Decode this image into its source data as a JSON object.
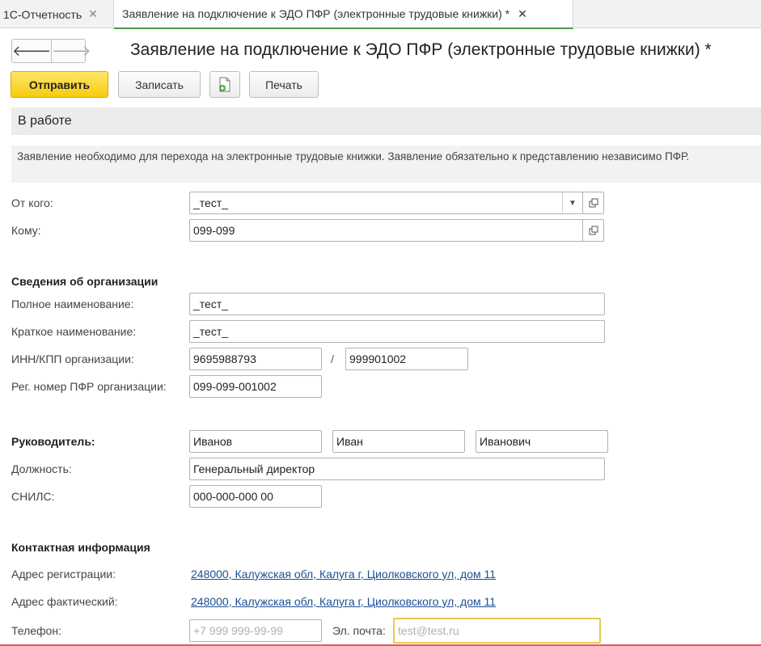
{
  "tabs": [
    {
      "label": "1С-Отчетность",
      "close": "✕"
    },
    {
      "label": "Заявление на подключение к ЭДО ПФР (электронные трудовые книжки) *",
      "close": "✕"
    }
  ],
  "nav": {
    "back": "🡐",
    "forward": "🡒"
  },
  "title": "Заявление на подключение к ЭДО ПФР (электронные трудовые книжки) *",
  "toolbar": {
    "send": "Отправить",
    "save": "Записать",
    "print": "Печать"
  },
  "status": "В работе",
  "info": "Заявление необходимо для перехода на электронные трудовые книжки. Заявление обязательно к представлению независимо ПФР.",
  "form": {
    "from_label": "От кого:",
    "from_value": "_тест_",
    "to_label": "Кому:",
    "to_value": "099-099",
    "org_section": "Сведения об организации",
    "full_name_label": "Полное наименование:",
    "full_name_value": "_тест_",
    "short_name_label": "Краткое наименование:",
    "short_name_value": "_тест_",
    "inn_kpp_label": "ИНН/КПП организации:",
    "inn_value": "9695988793",
    "inn_kpp_sep": "/",
    "kpp_value": "999901002",
    "pfr_label": "Рег. номер ПФР организации:",
    "pfr_value": "099-099-001002",
    "head_section": "Руководитель:",
    "head_last": "Иванов",
    "head_first": "Иван",
    "head_middle": "Иванович",
    "position_label": "Должность:",
    "position_value": "Генеральный директор",
    "snils_label": "СНИЛС:",
    "snils_value": "000-000-000 00",
    "contact_section": "Контактная информация",
    "reg_addr_label": "Адрес регистрации:",
    "reg_addr_value": "248000, Калужская обл, Калуга г, Циолковского ул, дом 11",
    "fact_addr_label": "Адрес фактический:",
    "fact_addr_value": "248000, Калужская обл, Калуга г, Циолковского ул, дом 11",
    "phone_label": "Телефон:",
    "phone_placeholder": "+7 999 999-99-99",
    "email_label": "Эл. почта:",
    "email_placeholder": "test@test.ru"
  },
  "icons": {
    "dropdown": "chevron-down-icon",
    "open": "open-form-icon",
    "save_copy": "save-document-icon"
  },
  "colors": {
    "send_button": "#f6cc0c",
    "link": "#1b4f93",
    "active_tab_underline": "#4a9a4a",
    "focus_border": "#e7c94a"
  }
}
